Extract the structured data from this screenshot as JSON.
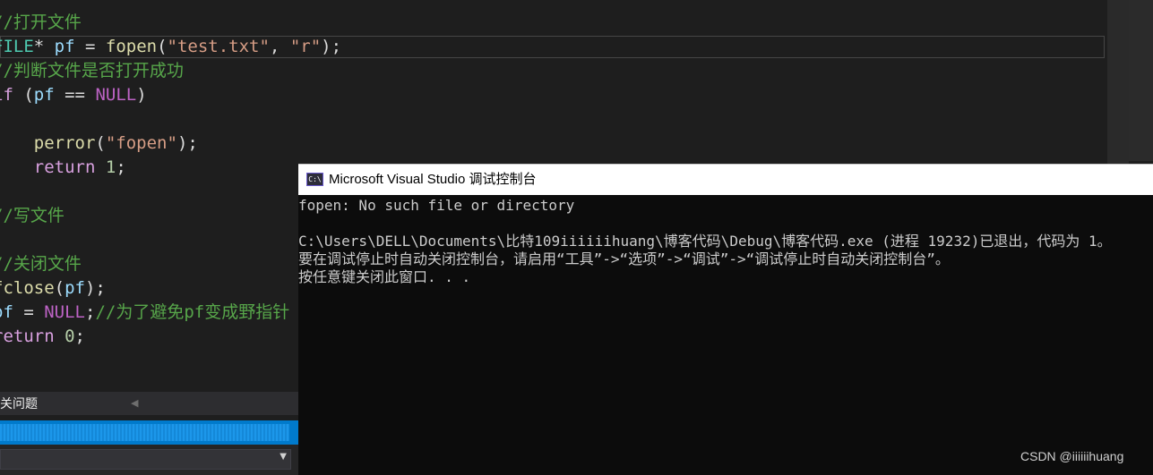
{
  "editor": {
    "lines": [
      {
        "parts": [
          {
            "t": "//打开文件",
            "c": "cmt"
          }
        ]
      },
      {
        "parts": [
          {
            "t": "FILE",
            "c": "typ"
          },
          {
            "t": "* ",
            "c": "plain"
          },
          {
            "t": "pf",
            "c": "var"
          },
          {
            "t": " = ",
            "c": "plain"
          },
          {
            "t": "fopen",
            "c": "fn"
          },
          {
            "t": "(",
            "c": "plain"
          },
          {
            "t": "\"test.txt\"",
            "c": "str"
          },
          {
            "t": ", ",
            "c": "plain"
          },
          {
            "t": "\"r\"",
            "c": "str"
          },
          {
            "t": ");",
            "c": "plain"
          }
        ]
      },
      {
        "parts": [
          {
            "t": "//判断文件是否打开成功",
            "c": "cmt"
          }
        ]
      },
      {
        "parts": [
          {
            "t": "if",
            "c": "kw"
          },
          {
            "t": " (",
            "c": "plain"
          },
          {
            "t": "pf",
            "c": "var"
          },
          {
            "t": " == ",
            "c": "plain"
          },
          {
            "t": "NULL",
            "c": "mac"
          },
          {
            "t": ")",
            "c": "plain"
          }
        ]
      },
      {
        "parts": []
      },
      {
        "parts": [
          {
            "t": "    ",
            "c": "plain"
          },
          {
            "t": "perror",
            "c": "fn"
          },
          {
            "t": "(",
            "c": "plain"
          },
          {
            "t": "\"fopen\"",
            "c": "str"
          },
          {
            "t": ");",
            "c": "plain"
          }
        ]
      },
      {
        "parts": [
          {
            "t": "    ",
            "c": "plain"
          },
          {
            "t": "return",
            "c": "kw"
          },
          {
            "t": " ",
            "c": "plain"
          },
          {
            "t": "1",
            "c": "num"
          },
          {
            "t": ";",
            "c": "plain"
          }
        ]
      },
      {
        "parts": []
      },
      {
        "parts": [
          {
            "t": "//写文件",
            "c": "cmt"
          }
        ]
      },
      {
        "parts": []
      },
      {
        "parts": [
          {
            "t": "//关闭文件",
            "c": "cmt"
          }
        ]
      },
      {
        "parts": [
          {
            "t": "fclose",
            "c": "fn"
          },
          {
            "t": "(",
            "c": "plain"
          },
          {
            "t": "pf",
            "c": "var"
          },
          {
            "t": ");",
            "c": "plain"
          }
        ]
      },
      {
        "parts": [
          {
            "t": "pf",
            "c": "var"
          },
          {
            "t": " = ",
            "c": "plain"
          },
          {
            "t": "NULL",
            "c": "mac"
          },
          {
            "t": ";",
            "c": "plain"
          },
          {
            "t": "//为了避免pf变成野指针",
            "c": "cmt"
          }
        ]
      },
      {
        "parts": [
          {
            "t": "return",
            "c": "kw"
          },
          {
            "t": " ",
            "c": "plain"
          },
          {
            "t": "0",
            "c": "num"
          },
          {
            "t": ";",
            "c": "plain"
          }
        ]
      }
    ]
  },
  "panel": {
    "error_tab_label": "关问题",
    "scroll_left_glyph": "◀",
    "progress_fraction": 0.97
  },
  "console": {
    "icon_text": "C:\\",
    "title": "Microsoft Visual Studio 调试控制台",
    "lines": [
      "fopen: No such file or directory",
      "",
      "C:\\Users\\DELL\\Documents\\比特109iiiiiihuang\\博客代码\\Debug\\博客代码.exe (进程 19232)已退出，代码为 1。",
      "要在调试停止时自动关闭控制台，请启用“工具”->“选项”->“调试”->“调试停止时自动关闭控制台”。",
      "按任意键关闭此窗口. . ."
    ]
  },
  "watermark": "CSDN @iiiiiihuang",
  "dropdown_arrow": "▼"
}
